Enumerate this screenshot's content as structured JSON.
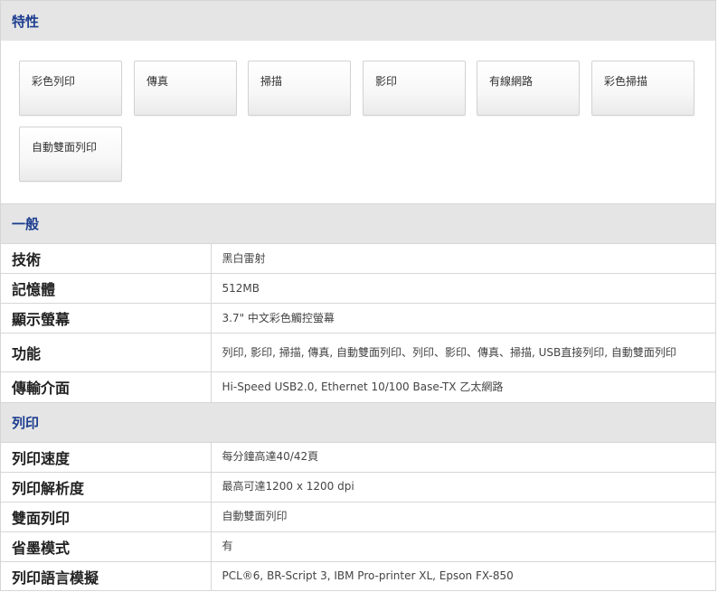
{
  "sections": {
    "features": {
      "title": "特性",
      "items": [
        "彩色列印",
        "傳真",
        "掃描",
        "影印",
        "有線網路",
        "彩色掃描",
        "自動雙面列印"
      ]
    },
    "general": {
      "title": "一般",
      "rows": [
        {
          "label": "技術",
          "value": "黑白雷射"
        },
        {
          "label": "記憶體",
          "value": "512MB"
        },
        {
          "label": "顯示螢幕",
          "value": "3.7\" 中文彩色觸控螢幕"
        },
        {
          "label": "功能",
          "value": "列印, 影印, 掃描, 傳真, 自動雙面列印、列印、影印、傳真、掃描, USB直接列印, 自動雙面列印"
        },
        {
          "label": "傳輸介面",
          "value": "Hi-Speed USB2.0, Ethernet 10/100 Base-TX 乙太網路"
        }
      ]
    },
    "print": {
      "title": "列印",
      "rows": [
        {
          "label": "列印速度",
          "value": "每分鐘高達40/42頁"
        },
        {
          "label": "列印解析度",
          "value": "最高可達1200 x 1200 dpi"
        },
        {
          "label": "雙面列印",
          "value": "自動雙面列印"
        },
        {
          "label": "省墨模式",
          "value": "有"
        },
        {
          "label": "列印語言模擬",
          "value": "PCL®6, BR-Script 3, IBM Pro-printer XL, Epson FX-850"
        }
      ]
    }
  },
  "colors": {
    "section_title": "#1d3e8f",
    "header_bg": "#e5e5e5",
    "border": "#d6d6d6"
  }
}
